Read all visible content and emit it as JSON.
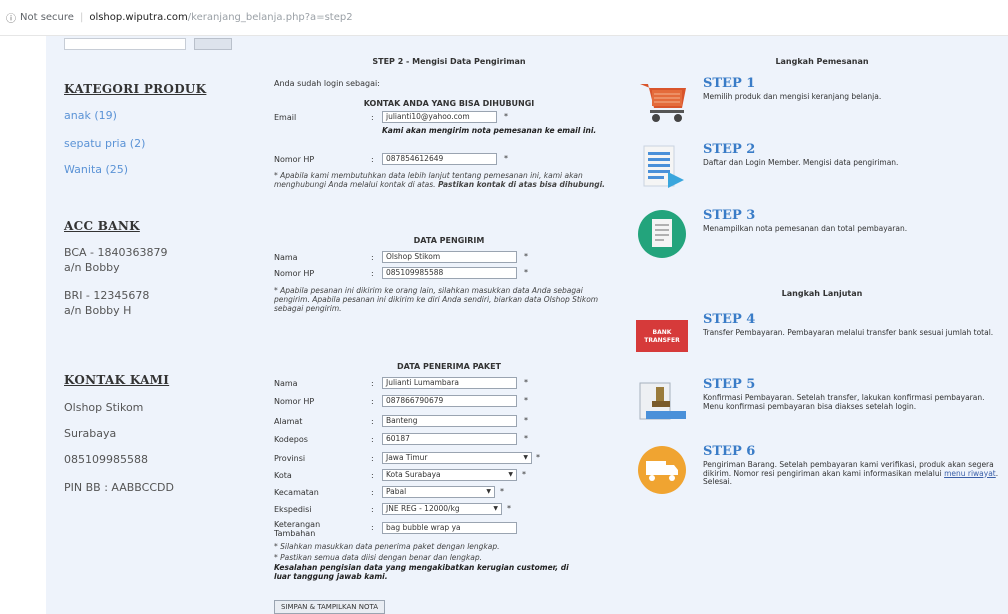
{
  "address_bar": {
    "security": "Not secure",
    "host": "olshop.wiputra.com",
    "path": "/keranjang_belanja.php?a=step2"
  },
  "sidebar": {
    "kategori_title": "KATEGORI PRODUK",
    "kategori": [
      "anak (19)",
      "sepatu pria (2)",
      "Wanita (25)"
    ],
    "bank_title": "ACC BANK",
    "banks": [
      {
        "line1": "BCA - 1840363879",
        "line2": "a/n Bobby"
      },
      {
        "line1": "BRI - 12345678",
        "line2": "a/n Bobby H"
      }
    ],
    "kontak_title": "KONTAK KAMI",
    "kontak": [
      "Olshop Stikom",
      "Surabaya",
      "085109985588",
      "PIN BB : AABBCCDD"
    ]
  },
  "form": {
    "step_title": "STEP 2 - Mengisi Data Pengiriman",
    "login_note": "Anda sudah login sebagai:",
    "kontak_section": "KONTAK ANDA YANG BISA DIHUBUNGI",
    "email_label": "Email",
    "email_value": "julianti10@yahoo.com",
    "email_note": "Kami akan mengirim nota pemesanan ke email ini.",
    "hp_label": "Nomor HP",
    "hp_value": "087854612649",
    "kontak_note_a": "* Apabila kami membutuhkan data lebih lanjut tentang pemesanan ini, kami akan menghubungi Anda melalui kontak di atas.",
    "kontak_note_b": "Pastikan kontak di atas bisa dihubungi.",
    "pengirim_section": "DATA PENGIRIM",
    "nama_label": "Nama",
    "pengirim_nama": "Olshop Stikom",
    "pengirim_hp": "085109985588",
    "pengirim_note": "* Apabila pesanan ini dikirim ke orang lain, silahkan masukkan data Anda sebagai pengirim. Apabila pesanan ini dikirim ke diri Anda sendiri, biarkan data Olshop Stikom sebagai pengirim.",
    "penerima_section": "DATA PENERIMA PAKET",
    "alamat_label": "Alamat",
    "kodepos_label": "Kodepos",
    "provinsi_label": "Provinsi",
    "kota_label": "Kota",
    "kecamatan_label": "Kecamatan",
    "ekspedisi_label": "Ekspedisi",
    "keterangan_label": "Keterangan Tambahan",
    "penerima_nama": "Julianti Lumambara",
    "penerima_hp": "087866790679",
    "alamat": "Banteng",
    "kodepos": "60187",
    "provinsi": "Jawa Timur",
    "kota": "Kota Surabaya",
    "kecamatan": "Pabal",
    "ekspedisi": "JNE REG - 12000/kg",
    "keterangan": "bag bubble wrap ya",
    "req": "*",
    "note1": "* Silahkan masukkan data penerima paket dengan lengkap.",
    "note2": "* Pastikan semua data diisi dengan benar dan lengkap.",
    "note3": "Kesalahan pengisian data yang mengakibatkan kerugian customer, di luar tanggung jawab kami.",
    "submit_label": "SIMPAN & TAMPILKAN NOTA"
  },
  "right": {
    "heading1": "Langkah Pemesanan",
    "heading2": "Langkah Lanjutan",
    "steps": [
      {
        "title": "STEP 1",
        "desc": "Memilih produk dan mengisi keranjang belanja.",
        "icon": "cart-icon"
      },
      {
        "title": "STEP 2",
        "desc": "Daftar dan Login Member. Mengisi data pengiriman.",
        "icon": "document-icon"
      },
      {
        "title": "STEP 3",
        "desc": "Menampilkan nota pemesanan dan total pembayaran.",
        "icon": "receipt-icon"
      },
      {
        "title": "STEP 4",
        "desc": "Transfer Pembayaran. Pembayaran melalui transfer bank sesuai jumlah total.",
        "icon": "bank-transfer-icon",
        "icon_text": "BANK TRANSFER"
      },
      {
        "title": "STEP 5",
        "desc": "Konfirmasi Pembayaran. Setelah transfer, lakukan konfirmasi pembayaran. Menu konfirmasi pembayaran bisa diakses setelah login.",
        "icon": "stamp-icon"
      },
      {
        "title": "STEP 6",
        "desc": "Pengiriman Barang. Setelah pembayaran kami verifikasi, produk akan segera dikirim. Nomor resi pengiriman akan kami informasikan melalui",
        "link": "menu riwayat",
        "desc_end": "Selesai.",
        "icon": "truck-icon"
      }
    ]
  }
}
